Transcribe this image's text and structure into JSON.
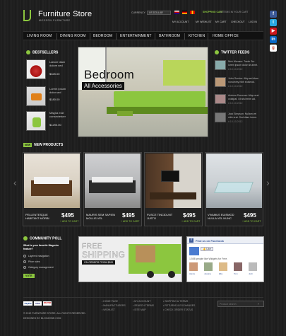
{
  "brand": {
    "name": "Furniture Store",
    "tagline": "MODERN FURNITURE"
  },
  "header": {
    "currency_label": "CURRENCY",
    "currency_value": "US DOLLAR",
    "cart_label": "SHOPPING CART",
    "cart_status": "0 ITEMS IN YOUR CART",
    "account_links": [
      "MY ACCOUNT",
      "MY WISHLIST",
      "MY CART",
      "CHECKOUT",
      "LOG IN"
    ]
  },
  "social": [
    "facebook-icon",
    "twitter-icon",
    "youtube-icon",
    "linkedin-icon",
    "google-icon"
  ],
  "nav": [
    "LIVING ROOM",
    "DINING ROOM",
    "BEDROOM",
    "ENTERTAINMENT",
    "BATHROOM",
    "KITCHEN",
    "HOME OFFICE"
  ],
  "bestsellers": {
    "title": "BESTSELLERS",
    "items": [
      {
        "name": "Labore diam dolore sed",
        "price": "$325.00"
      },
      {
        "name": "Lorem ipsum dolor sed",
        "price": "$180.00"
      },
      {
        "name": "Magna erat consectetuer",
        "price": "$1290.00"
      }
    ]
  },
  "hero": {
    "title": "Bedroom",
    "subtitle": "All Accessories"
  },
  "twitter": {
    "title": "TWITTER FEEDS",
    "items": [
      {
        "text": "Nick Monaco: Trade Sur lorem ipsum dolor sit amet.",
        "date": "# 10.10.2012"
      },
      {
        "text": "John Gordon: Aliq sed diam nonummy nibh euismod.",
        "date": "# 10.10.2012"
      },
      {
        "text": "Andrew Donovan: Aliqu erat volutpat. Ut wisi enim ad.",
        "date": "# 10.10.2012"
      },
      {
        "text": "Jack Simpson: Nullam vel nibh erat. Sed diam lorem.",
        "date": "# 10.10.2012"
      }
    ]
  },
  "new_products": {
    "title": "NEW PRODUCTS",
    "add_label": "ADD TO CART",
    "items": [
      {
        "name": "PELLENTESQUE HABITANT MORBI",
        "price": "$495"
      },
      {
        "name": "MAURIS SEM SAPIEN MOLLIS VEL",
        "price": "$495"
      },
      {
        "name": "FUSCE TINCIDUNT JUSTO",
        "price": "$495"
      },
      {
        "name": "VIVAMUS EUISMOD NULLA VEL NUNC",
        "price": "$495"
      }
    ]
  },
  "poll": {
    "title": "COMMUNITY POLL",
    "question": "What is your favorite Magento feature?",
    "options": [
      "Layered navigation",
      "Price rules",
      "Category management"
    ],
    "vote": "VOTE"
  },
  "shipping": {
    "line1": "FREE",
    "line2": "SHIPPING",
    "line3": "ON ORDERS FROM $200"
  },
  "facebook": {
    "title": "Find us on Facebook",
    "like_line": "1,558 people like Widgets for Free.",
    "names": [
      "Alexis",
      "Joanna",
      "Ella",
      "Tom",
      "Jodi"
    ]
  },
  "footer": {
    "copyright": "© 2012 FURNITURE STORE. ALL RIGHTS RESERVED.",
    "designed": "DESIGNED BY BLOGZONE.COM",
    "payment": [
      "PayPal",
      "VISA",
      "MASTER"
    ],
    "col1": [
      "HOME PAGE",
      "MANUFACTURERS",
      "WISHLIST"
    ],
    "col2": [
      "MY ACCOUNT",
      "SEARCH TERMS",
      "SITE MAP"
    ],
    "col3": [
      "SHIPPING & TERMS",
      "RETURNS & EXCHANGES",
      "CHECK ORDER STATUS"
    ],
    "search_placeholder": "Product search"
  },
  "colors": {
    "accent": "#8cc63f",
    "bg": "#1b1b1b"
  }
}
